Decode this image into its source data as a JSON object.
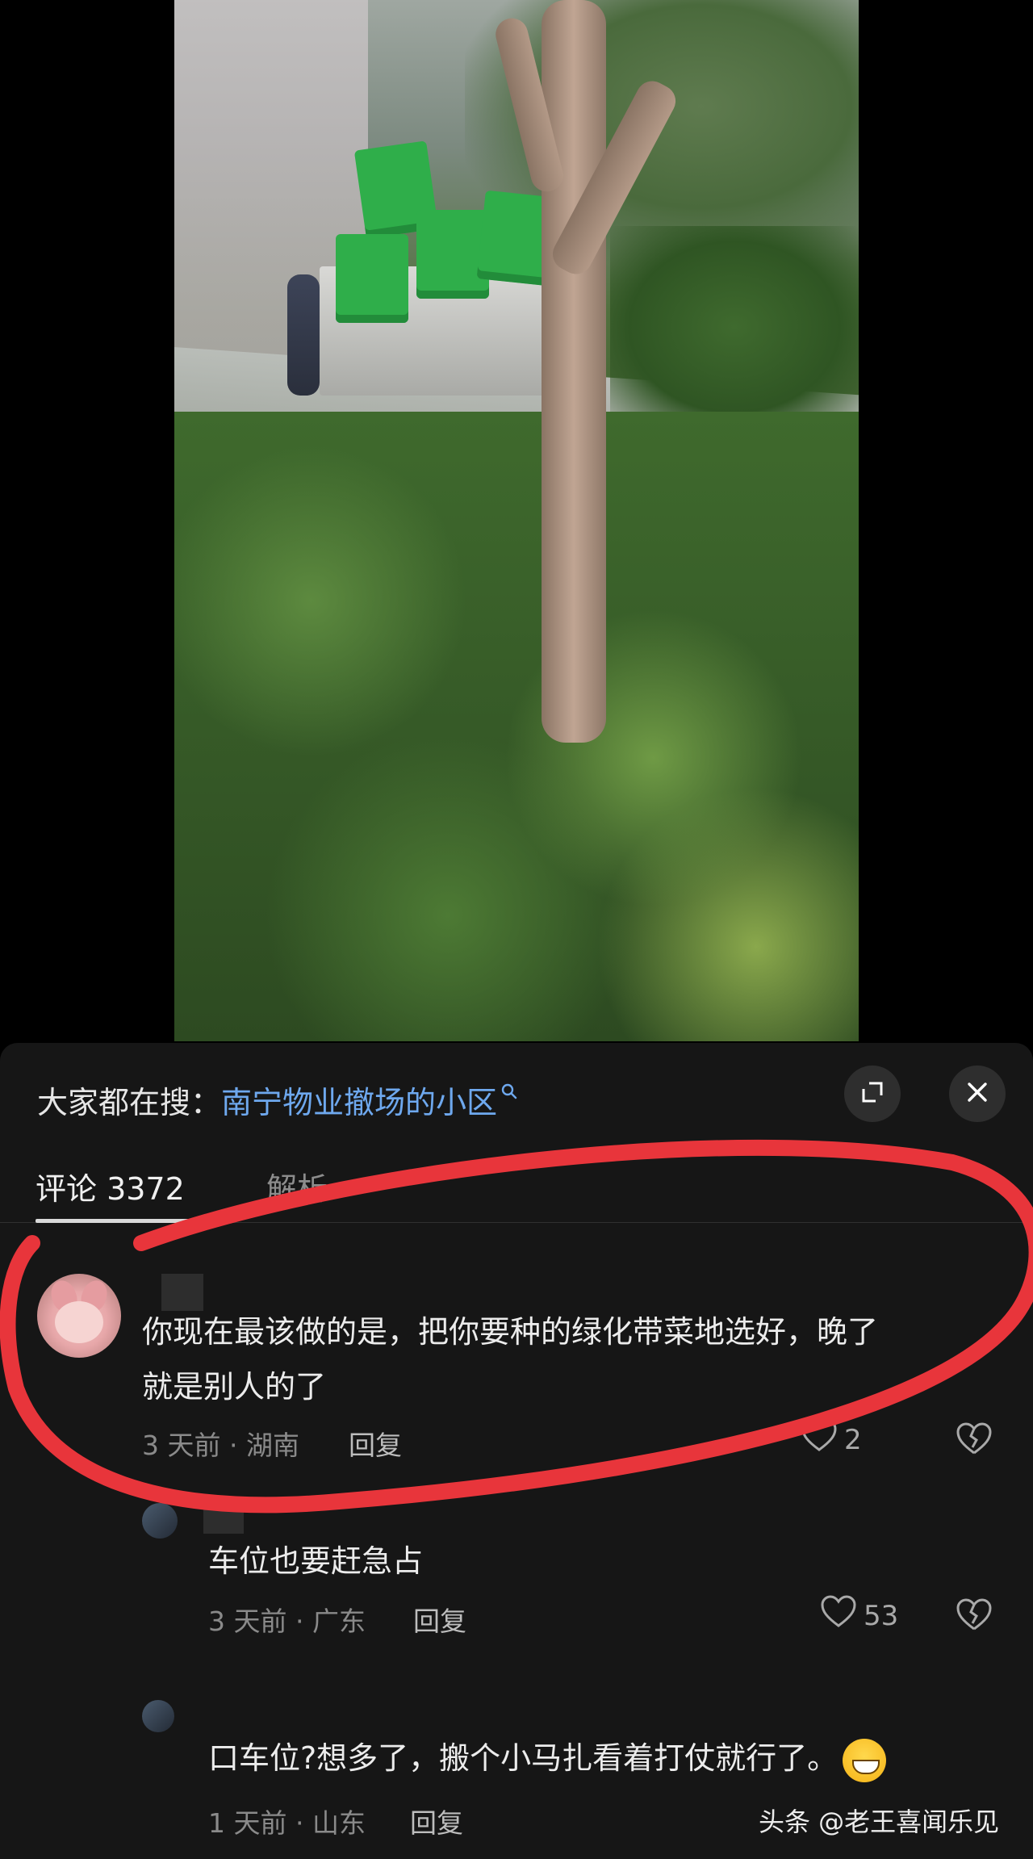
{
  "video": {
    "description_icon": "video-frame"
  },
  "search": {
    "prefix": "大家都在搜：",
    "query": "南宁物业撤场的小区"
  },
  "controls": {
    "expand_icon": "expand-icon",
    "close_icon": "close-icon"
  },
  "tabs": {
    "comments_label": "评论 3372",
    "analysis_label": "解析"
  },
  "comments": [
    {
      "text_line1": "你现在最该做的是，把你要种的绿化带菜地选好，晚了",
      "text_line2": "就是别人的了",
      "meta": "3 天前 · 湖南",
      "reply": "回复",
      "likes": "2"
    },
    {
      "text": "车位也要赶急占",
      "meta": "3 天前 · 广东",
      "reply": "回复",
      "likes": "53"
    },
    {
      "text": "口车位?想多了，搬个小马扎看着打仗就行了。",
      "meta": "1 天前 · 山东",
      "reply": "回复"
    }
  ],
  "watermark": "头条 @老王喜闻乐见",
  "colors": {
    "panel_bg": "#161616",
    "link": "#6ea8ee",
    "marker": "#e8353b"
  }
}
